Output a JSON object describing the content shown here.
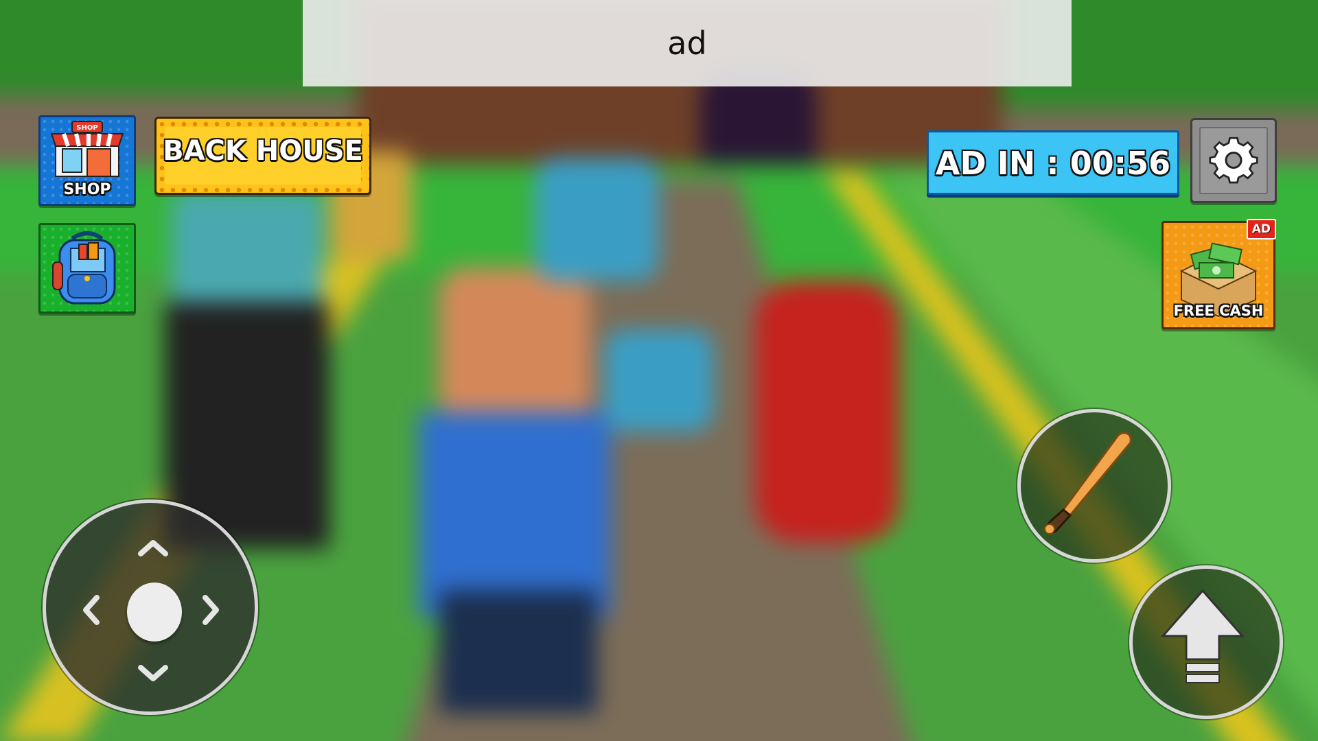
{
  "ad_banner": {
    "text": "ad"
  },
  "hud": {
    "shop": {
      "label": "SHOP",
      "sign_text": "SHOP",
      "icon": "storefront-icon"
    },
    "back_house": {
      "label": "BACK HOUSE"
    },
    "backpack": {
      "icon": "backpack-icon"
    },
    "ad_timer": {
      "text": "AD IN : 00:56"
    },
    "settings": {
      "icon": "gear-icon"
    },
    "free_cash": {
      "label": "FREE CASH",
      "badge": "AD",
      "icon": "cash-box-icon"
    },
    "attack": {
      "icon": "baseball-bat-icon"
    },
    "jump": {
      "icon": "up-arrow-icon"
    },
    "joystick": {
      "icons": [
        "chevron-up-icon",
        "chevron-down-icon",
        "chevron-left-icon",
        "chevron-right-icon"
      ]
    }
  },
  "colors": {
    "shop_bg": "#1576d6",
    "backpack_bg": "#19b02c",
    "back_house_bg": "#ffc21a",
    "ad_timer_bg": "#3cc4f4",
    "free_cash_bg": "#f59a15",
    "ad_badge_bg": "#e3241b"
  }
}
